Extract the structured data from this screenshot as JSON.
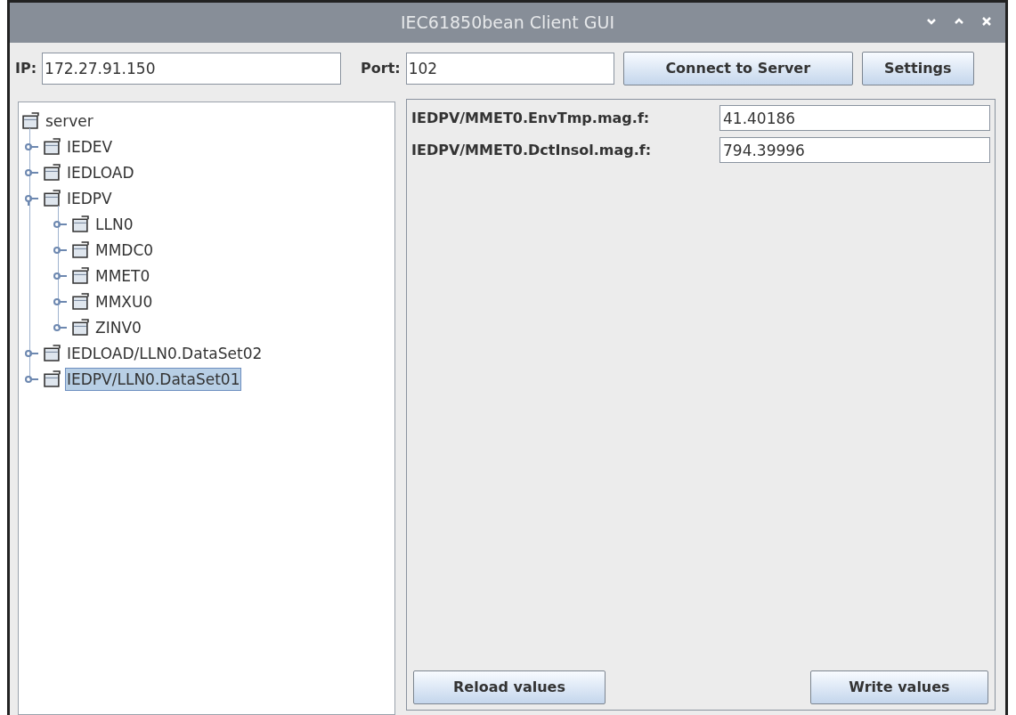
{
  "window": {
    "title": "IEC61850bean Client GUI"
  },
  "connection": {
    "ip_label": "IP:",
    "ip": "172.27.91.150",
    "port_label": "Port:",
    "port": "102",
    "buttons": [
      "Connect to Server",
      "Settings"
    ]
  },
  "tree": {
    "label": "server",
    "selected": false,
    "children": [
      {
        "label": "IEDEV",
        "selected": false,
        "expanded": false
      },
      {
        "label": "IEDLOAD",
        "selected": false,
        "expanded": false
      },
      {
        "label": "IEDPV",
        "selected": false,
        "expanded": true,
        "children": [
          {
            "label": "LLN0",
            "selected": false,
            "expanded": false
          },
          {
            "label": "MMDC0",
            "selected": false,
            "expanded": false
          },
          {
            "label": "MMET0",
            "selected": false,
            "expanded": false
          },
          {
            "label": "MMXU0",
            "selected": false,
            "expanded": false
          },
          {
            "label": "ZINV0",
            "selected": false,
            "expanded": false
          }
        ]
      },
      {
        "label": "IEDLOAD/LLN0.DataSet02",
        "selected": false,
        "expanded": false
      },
      {
        "label": "IEDPV/LLN0.DataSet01",
        "selected": true,
        "expanded": false
      }
    ]
  },
  "values": [
    {
      "label": "IEDPV/MMET0.EnvTmp.mag.f:",
      "value": "41.40186"
    },
    {
      "label": "IEDPV/MMET0.DctInsol.mag.f:",
      "value": "794.39996"
    }
  ],
  "bottom_buttons": [
    "Reload values",
    "Write values"
  ]
}
